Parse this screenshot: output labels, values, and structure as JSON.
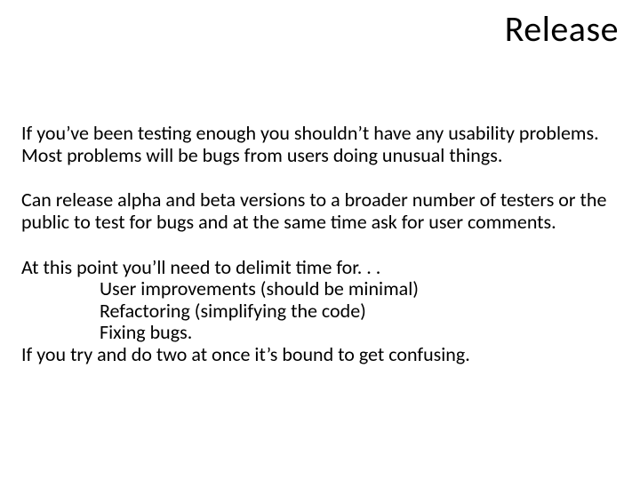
{
  "title": "Release",
  "p1": "If you’ve been testing enough you shouldn’t have any usability problems. Most problems will be bugs from users doing unusual things.",
  "p2": "Can release alpha and beta versions to a broader number of testers or the public to test for bugs and at the same time ask for user comments.",
  "p3_lead": "At this point you’ll need to delimit time for. . .",
  "p3_items": {
    "a": "User improvements (should be minimal)",
    "b": "Refactoring (simplifying the code)",
    "c": "Fixing bugs."
  },
  "p3_tail": "If you try and do two at once it’s bound to get confusing."
}
